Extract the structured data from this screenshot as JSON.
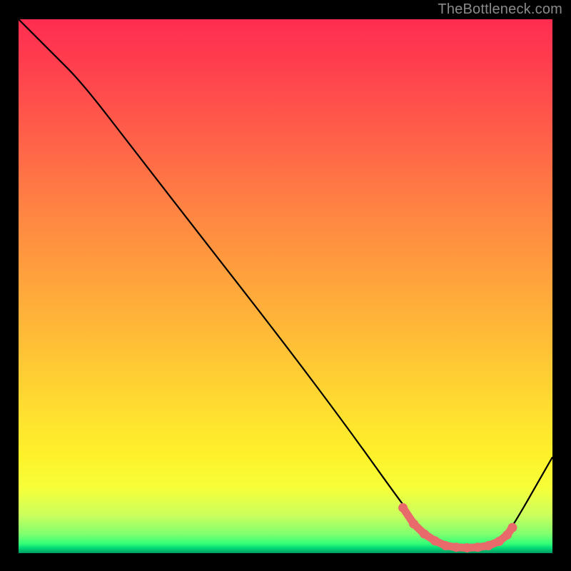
{
  "attribution": "TheBottleneck.com",
  "chart_data": {
    "type": "line",
    "title": "",
    "xlabel": "",
    "ylabel": "",
    "xlim": [
      0,
      100
    ],
    "ylim": [
      0,
      100
    ],
    "series": [
      {
        "name": "bottleneck-curve",
        "x": [
          0,
          6,
          12,
          22,
          36,
          50,
          62,
          72,
          76,
          78,
          80,
          82,
          84,
          86,
          88,
          90,
          92,
          100
        ],
        "y": [
          100,
          94,
          88,
          75,
          57,
          39,
          23,
          9,
          4,
          2,
          1.2,
          1.0,
          1.0,
          1.0,
          1.2,
          2,
          4,
          18
        ]
      },
      {
        "name": "optimal-range-markers",
        "x": [
          72,
          74,
          76,
          78,
          80,
          82,
          84,
          86,
          88,
          90,
          91.5,
          92.5
        ],
        "y": [
          8.5,
          5.5,
          3.6,
          2.3,
          1.4,
          1.1,
          1.0,
          1.1,
          1.4,
          2.2,
          3.4,
          4.8
        ]
      }
    ],
    "colors": {
      "curve": "#000000",
      "markers": "#e86a6a",
      "gradient_top": "#ff2d50",
      "gradient_mid": "#ffd633",
      "gradient_bottom": "#009a63"
    }
  }
}
